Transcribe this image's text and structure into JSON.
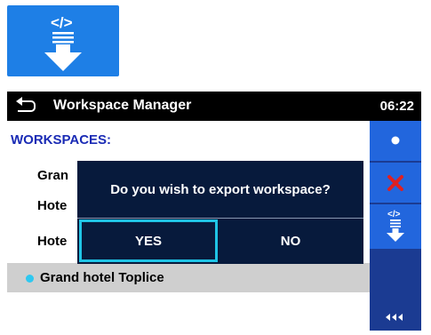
{
  "header": {
    "title": "Workspace Manager",
    "time": "06:22"
  },
  "list": {
    "section_title": "WORKSPACES:",
    "rows": [
      "Gran",
      "Hote",
      "Hote"
    ],
    "selected": "Grand hotel Toplice"
  },
  "dialog": {
    "question": "Do you wish to export workspace?",
    "yes_label": "YES",
    "no_label": "NO"
  },
  "icons": {
    "export_tile": "export-workspace-icon",
    "back": "back-arrow-icon",
    "select": "dot-icon",
    "delete": "red-x-icon",
    "export": "export-workspace-icon",
    "collapse": "collapse-arrows-icon"
  },
  "colors": {
    "accent_blue": "#1e7fe6",
    "sidebar": "#1b3b92",
    "dialog": "#071a3c",
    "highlight": "#1fc4e6",
    "delete_red": "#e02020"
  }
}
